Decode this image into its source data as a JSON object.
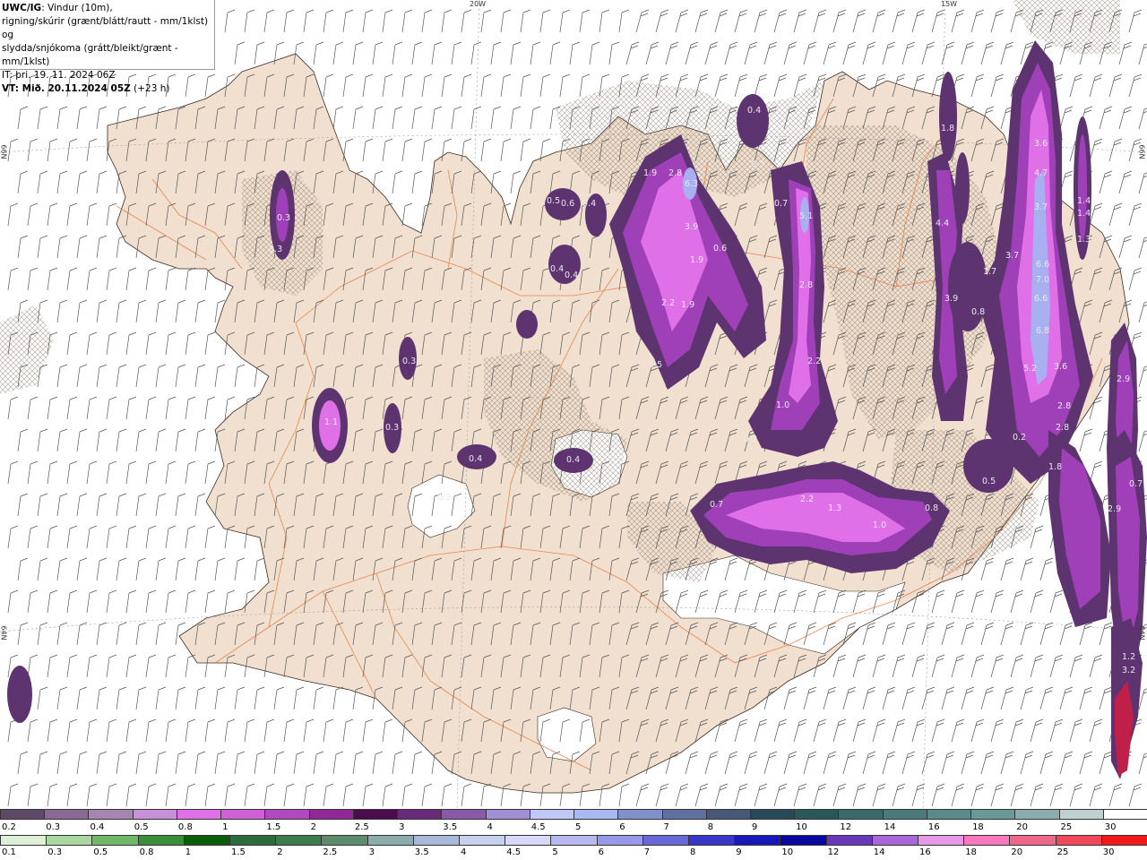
{
  "header": {
    "title_bold": "UWC/IG",
    "title_rest": ": Vindur (10m),",
    "line2": "rigning/skúrir (grænt/blátt/rautt - mm/1klst) og",
    "line3": "slydda/snjókoma (grátt/bleikt/grænt - mm/1klst)",
    "line4": "IT: þri. 19. 11. 2024 06Z",
    "line5_bold": "VT: Mið. 20.11.2024 05Z",
    "line5_rest": " (+23 h)"
  },
  "graticule": {
    "lon_20w": "20W",
    "lon_15w": "15W",
    "lat_66n_left": "66N",
    "lat_66n_right": "66N",
    "lat_64n_left": "64N",
    "lat_64n_right": "64N"
  },
  "colors": {
    "land": "#f1e0cf",
    "ocean": "#ffffff",
    "roads": "#e8743c",
    "snow_dark": "#5e3470",
    "snow_mid": "#a040b8",
    "snow_light": "#e070e8",
    "snow_core": "#a8b0f0"
  },
  "precip_labels": [
    {
      "v": "0.3"
    },
    {
      "v": "0.3"
    },
    {
      "v": "0.3"
    },
    {
      "v": "1.1"
    },
    {
      "v": "0.3"
    },
    {
      "v": "0.4"
    },
    {
      "v": "0.3"
    },
    {
      "v": "0.4"
    },
    {
      "v": "0.5"
    },
    {
      "v": "0.6"
    },
    {
      "v": "0.4"
    },
    {
      "v": "0.4"
    },
    {
      "v": "0.4"
    },
    {
      "v": "1.9"
    },
    {
      "v": "2.8"
    },
    {
      "v": "6.3"
    },
    {
      "v": "3.9"
    },
    {
      "v": "1.9"
    },
    {
      "v": "2.2"
    },
    {
      "v": "1.9"
    },
    {
      "v": "0.5"
    },
    {
      "v": "0.6"
    },
    {
      "v": "0.4"
    },
    {
      "v": "0.3"
    },
    {
      "v": "0.7"
    },
    {
      "v": "5.1"
    },
    {
      "v": "2.8"
    },
    {
      "v": "2.2"
    },
    {
      "v": "1.0"
    },
    {
      "v": "0.3"
    },
    {
      "v": "0.7"
    },
    {
      "v": "2.2"
    },
    {
      "v": "1.3"
    },
    {
      "v": "1.0"
    },
    {
      "v": "0.8"
    },
    {
      "v": "1.8"
    },
    {
      "v": "4.4"
    },
    {
      "v": "3.9"
    },
    {
      "v": "1.7"
    },
    {
      "v": "0.8"
    },
    {
      "v": "3.7"
    },
    {
      "v": "3.6"
    },
    {
      "v": "4.7"
    },
    {
      "v": "3.7"
    },
    {
      "v": "6.6"
    },
    {
      "v": "7.0"
    },
    {
      "v": "6.6"
    },
    {
      "v": "6.8"
    },
    {
      "v": "5.2"
    },
    {
      "v": "3.6"
    },
    {
      "v": "2.8"
    },
    {
      "v": "2.8"
    },
    {
      "v": "1.8"
    },
    {
      "v": "0.2"
    },
    {
      "v": "0.5"
    },
    {
      "v": "1.4"
    },
    {
      "v": "1.4"
    },
    {
      "v": "1.3"
    },
    {
      "v": "2.9"
    },
    {
      "v": "2.9"
    },
    {
      "v": "1.2"
    },
    {
      "v": "3.2"
    },
    {
      "v": "0.7"
    }
  ],
  "legend_snow": {
    "labels": [
      "0.2",
      "0.3",
      "0.4",
      "0.5",
      "0.8",
      "1",
      "1.5",
      "2",
      "2.5",
      "3",
      "3.5",
      "4",
      "4.5",
      "5",
      "6",
      "7",
      "8",
      "9",
      "10",
      "12",
      "14",
      "16",
      "18",
      "20",
      "25",
      "30"
    ],
    "colors": [
      "#5e4a66",
      "#8a6a94",
      "#a486b0",
      "#c890d8",
      "#e070e8",
      "#d060d8",
      "#b048c0",
      "#902898",
      "#4a0c4c",
      "#6a2a7a",
      "#8a5aa8",
      "#a090d8",
      "#c0c8f8",
      "#a8b8f0",
      "#8090c8",
      "#6070a0",
      "#485878",
      "#284a58",
      "#2a5858",
      "#3a6a6a",
      "#4a7a7a",
      "#5a8a8a",
      "#6a9a98",
      "#8aacac",
      "#c0d0d0",
      "#ffffff"
    ]
  },
  "legend_rain": {
    "labels": [
      "0.1",
      "0.3",
      "0.5",
      "0.8",
      "1",
      "1.5",
      "2",
      "2.5",
      "3",
      "3.5",
      "4",
      "4.5",
      "5",
      "6",
      "7",
      "8",
      "9",
      "10",
      "12",
      "14",
      "16",
      "18",
      "20",
      "25",
      "30"
    ],
    "colors": [
      "#dff0d8",
      "#a8d8a0",
      "#70b868",
      "#3c8c3c",
      "#0c5c0c",
      "#2c6c3c",
      "#3c7c4c",
      "#5c8c6c",
      "#8cacac",
      "#a8b8d8",
      "#c8d0f0",
      "#d8d8f8",
      "#b8b8f0",
      "#9898e8",
      "#6868d8",
      "#3838c8",
      "#1818b8",
      "#0808a0",
      "#6838b8",
      "#a868d8",
      "#e898e8",
      "#f878c0",
      "#f06888",
      "#f04858",
      "#f01818"
    ]
  }
}
